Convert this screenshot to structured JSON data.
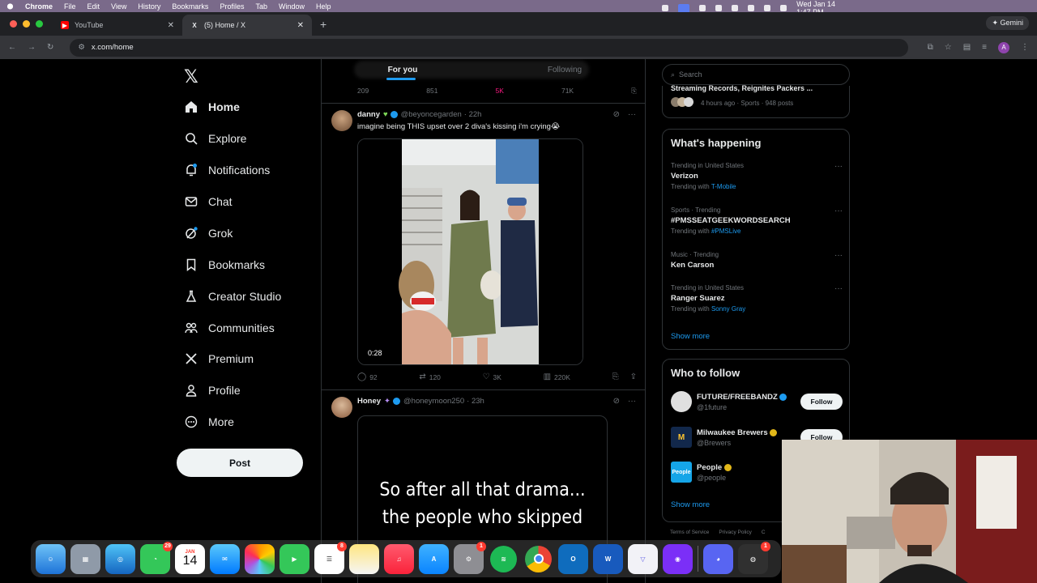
{
  "menubar": {
    "items": [
      "Chrome",
      "File",
      "Edit",
      "View",
      "History",
      "Bookmarks",
      "Profiles",
      "Tab",
      "Window",
      "Help"
    ],
    "clock": "Wed Jan 14  1:47 PM"
  },
  "browser": {
    "tabs": [
      {
        "label": "YouTube",
        "icon": "youtube-icon"
      },
      {
        "label": "(5) Home / X",
        "icon": "x-icon"
      }
    ],
    "gemini_label": "Gemini",
    "url": "x.com/home"
  },
  "nav": {
    "items": [
      {
        "label": "Home",
        "icon": "home-icon"
      },
      {
        "label": "Explore",
        "icon": "search-icon"
      },
      {
        "label": "Notifications",
        "icon": "bell-icon"
      },
      {
        "label": "Chat",
        "icon": "mail-icon"
      },
      {
        "label": "Grok",
        "icon": "grok-icon"
      },
      {
        "label": "Bookmarks",
        "icon": "bookmark-icon"
      },
      {
        "label": "Creator Studio",
        "icon": "flask-icon"
      },
      {
        "label": "Communities",
        "icon": "people-icon"
      },
      {
        "label": "Premium",
        "icon": "x-icon"
      },
      {
        "label": "Profile",
        "icon": "person-icon"
      },
      {
        "label": "More",
        "icon": "more-icon"
      }
    ],
    "post_label": "Post"
  },
  "feed": {
    "tabs": [
      "For you",
      "Following"
    ],
    "previous_actions": [
      "209",
      "851",
      "5K",
      "71K"
    ],
    "tweets": [
      {
        "name": "danny",
        "handle": "@beyoncegarden",
        "time": "· 22h",
        "text": "imagine being THIS upset over 2 diva's kissing i'm crying😭",
        "video_duration": "0:28",
        "replies": "92",
        "reposts": "120",
        "likes": "3K",
        "views": "220K"
      },
      {
        "name": "Honey",
        "handle": "@honeymoon250",
        "time": "· 23h",
        "media_text_1": "So after all that drama...",
        "media_text_2": "the people who skipped"
      }
    ]
  },
  "sidebar": {
    "search_placeholder": "Search",
    "top_story": {
      "title": "Streaming Records, Reignites Packers ...",
      "meta": "4 hours ago · Sports · 948 posts"
    },
    "happening": {
      "title": "What's happening",
      "trends": [
        {
          "meta": "Trending in United States",
          "title": "Verizon",
          "with_label": "Trending with",
          "with_link": "T-Mobile"
        },
        {
          "meta": "Sports · Trending",
          "title": "#PMSSEATGEEKWORDSEARCH",
          "with_label": "Trending with",
          "with_link": "#PMSLive"
        },
        {
          "meta": "Music · Trending",
          "title": "Ken Carson",
          "with_label": "",
          "with_link": ""
        },
        {
          "meta": "Trending in United States",
          "title": "Ranger Suarez",
          "with_label": "Trending with",
          "with_link": "Sonny Gray"
        }
      ],
      "show_more": "Show more"
    },
    "who_to_follow": {
      "title": "Who to follow",
      "accounts": [
        {
          "name": "FUTURE/FREEBANDZ",
          "handle": "@1future",
          "button": "Follow"
        },
        {
          "name": "Milwaukee Brewers",
          "handle": "@Brewers",
          "button": "Follow"
        },
        {
          "name": "People",
          "handle": "@people",
          "logo": "People"
        }
      ],
      "show_more": "Show more"
    },
    "footer": [
      "Terms of Service",
      "Privacy Policy",
      "C"
    ]
  },
  "dock": {
    "badges": {
      "messages": "29",
      "reminders": "8",
      "settings": "1",
      "music": "1"
    },
    "calendar_month": "JAN",
    "calendar_day": "14"
  },
  "colors": {
    "accent": "#1d9bf0",
    "background": "#000000",
    "border": "#2f3336",
    "muted": "#71767b"
  }
}
